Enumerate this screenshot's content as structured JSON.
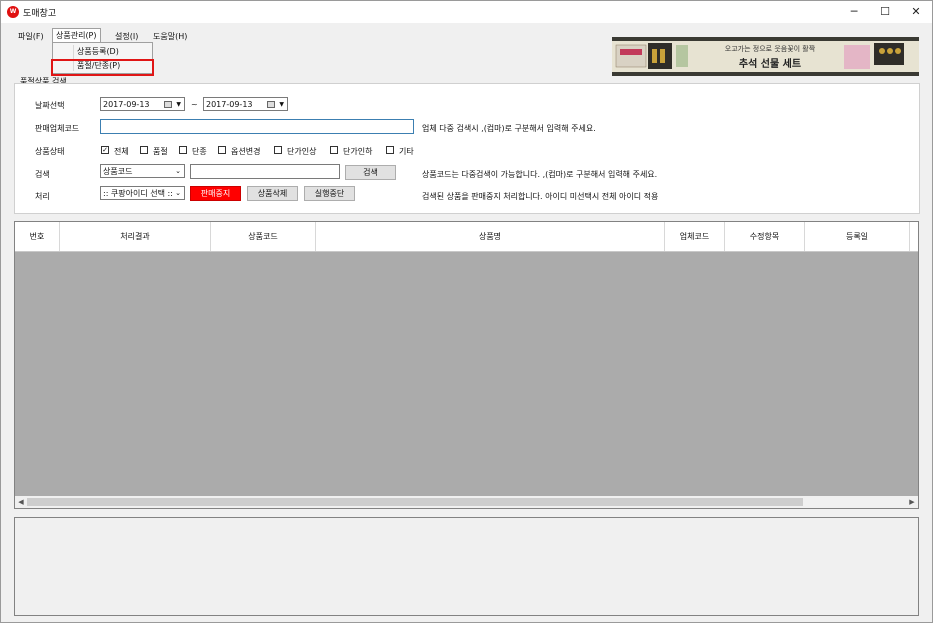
{
  "window": {
    "title": "도매창고",
    "app_icon": "W",
    "minimize": "─",
    "maximize": "☐",
    "close": "✕"
  },
  "menubar": {
    "file": "파일(F)",
    "product_mgmt": "상품관리(P)",
    "settings": "설정(I)",
    "help": "도움말(H)"
  },
  "dropdown": {
    "item1": "상품등록(D)",
    "item2": "품절/단종(P)"
  },
  "banner": {
    "line1": "오고가는 정으로 웃음꽃이 활짝",
    "line2": "추석 선물 세트"
  },
  "search_group": {
    "title": "품절상품 검색",
    "date_label": "날짜선택",
    "date_from": "2017-09-13",
    "date_tilde": "~",
    "date_to": "2017-09-13",
    "vendor_label": "판매업체코드",
    "vendor_hint": "업체 다중 검색시 ,(컴마)로 구분해서 입력해 주세요.",
    "status_label": "상품상태",
    "status_options": [
      {
        "label": "전체",
        "checked": true
      },
      {
        "label": "품절",
        "checked": false
      },
      {
        "label": "단종",
        "checked": false
      },
      {
        "label": "옵션변경",
        "checked": false
      },
      {
        "label": "단가인상",
        "checked": false
      },
      {
        "label": "단가인하",
        "checked": false
      },
      {
        "label": "기타",
        "checked": false
      }
    ],
    "search_label": "검색",
    "search_combo": "상품코드",
    "search_button": "검색",
    "search_hint": "상품코드는 다중검색이 가능합니다.  ,(컴마)로 구분해서 입력해 주세요.",
    "process_label": "처리",
    "process_combo": ":: 쿠팡아이디 선택 ::",
    "btn_stop_sale": "판매중지",
    "btn_delete": "상품삭제",
    "btn_cancel": "실행중단",
    "process_hint": "검색된 상품을 판매중지 처리합니다. 아이디 미선택시 전체 아이디 적용"
  },
  "grid": {
    "columns": [
      "번호",
      "처리결과",
      "상품코드",
      "상품명",
      "업체코드",
      "수정항목",
      "등록일"
    ]
  },
  "colors": {
    "accent_red": "#ff0000",
    "grid_bg": "#ababab"
  }
}
